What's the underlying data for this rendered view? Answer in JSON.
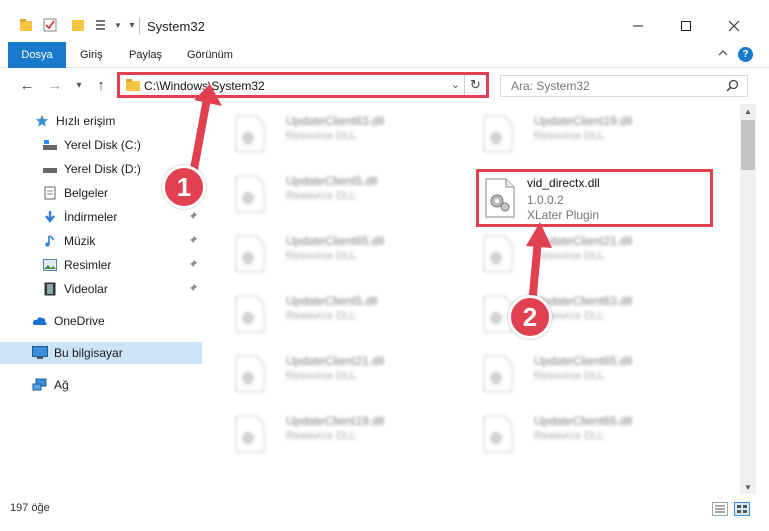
{
  "window": {
    "title": "System32"
  },
  "ribbon": {
    "tabs": [
      {
        "label": "Dosya"
      },
      {
        "label": "Giriş"
      },
      {
        "label": "Paylaş"
      },
      {
        "label": "Görünüm"
      }
    ],
    "help_label": "?"
  },
  "navbar": {
    "address": "C:\\Windows\\System32",
    "search_placeholder": "Ara: System32"
  },
  "sidebar": {
    "items": [
      {
        "label": "Hızlı erişim",
        "icon": "star-icon"
      },
      {
        "label": "Yerel Disk (C:)",
        "icon": "drive-icon"
      },
      {
        "label": "Yerel Disk (D:)",
        "icon": "drive-icon"
      },
      {
        "label": "Belgeler",
        "icon": "documents-icon"
      },
      {
        "label": "İndirmeler",
        "icon": "download-icon"
      },
      {
        "label": "Müzik",
        "icon": "music-icon"
      },
      {
        "label": "Resimler",
        "icon": "pictures-icon"
      },
      {
        "label": "Videolar",
        "icon": "video-icon"
      },
      {
        "label": "OneDrive",
        "icon": "cloud-icon"
      },
      {
        "label": "Bu bilgisayar",
        "icon": "computer-icon"
      },
      {
        "label": "Ağ",
        "icon": "network-icon"
      }
    ]
  },
  "files": [
    {
      "name": "UpdateClient63.dll",
      "desc": "Resource DLL"
    },
    {
      "name": "UpdateClient19.dll",
      "desc": "Resource DLL"
    },
    {
      "name": "UpdateClient5.dll",
      "desc": "Resource DLL"
    },
    {
      "name": "UpdateClient65.dll",
      "desc": "Resource DLL"
    },
    {
      "name": "UpdateClient21.dll",
      "desc": "Resource DLL"
    },
    {
      "name": "UpdateClient5.dll",
      "desc": "Resource DLL"
    },
    {
      "name": "UpdateClient63.dll",
      "desc": "Resource DLL"
    },
    {
      "name": "UpdateClient21.dll",
      "desc": "Resource DLL"
    },
    {
      "name": "UpdateClient65.dll",
      "desc": "Resource DLL"
    },
    {
      "name": "UpdateClient19.dll",
      "desc": "Resource DLL"
    },
    {
      "name": "UpdateClient65.dll",
      "desc": "Resource DLL"
    }
  ],
  "highlighted_file": {
    "name": "vid_directx.dll",
    "version": "1.0.0.2",
    "desc": "XLater Plugin"
  },
  "status": {
    "item_count": "197 öğe"
  },
  "annotations": {
    "badge1": "1",
    "badge2": "2",
    "color": "#e04050"
  },
  "colors": {
    "accent": "#1979ca",
    "selected": "#cce4f7",
    "annotation": "#e04050"
  }
}
